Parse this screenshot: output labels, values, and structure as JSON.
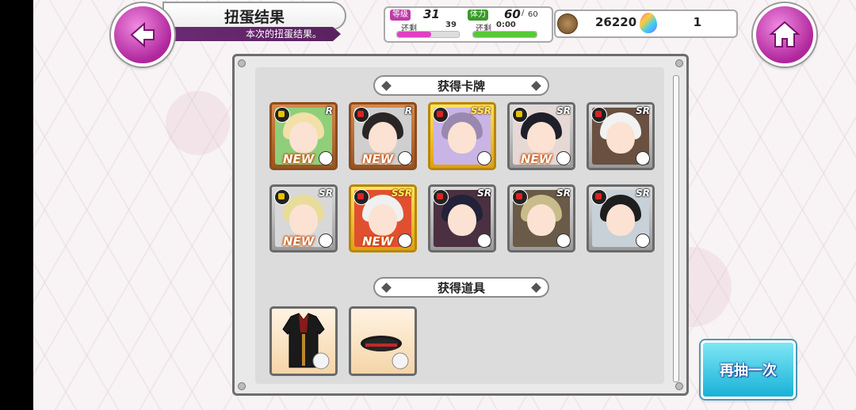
{
  "header": {
    "title": "扭蛋结果",
    "subtitle": "本次的扭蛋结果。"
  },
  "stats": {
    "level_label": "等级",
    "level_value": "31",
    "exp_label": "还剩",
    "exp_value": "39",
    "exp_fill": 0.55,
    "stamina_label": "体力",
    "stamina_value": "60",
    "stamina_sep": "/",
    "stamina_max": "60",
    "stamina_fill": 1.0,
    "recover_label": "还剩",
    "recover_value": "0:00"
  },
  "currency": {
    "coins": "26220",
    "gems": "1"
  },
  "cards_section": {
    "title": "获得卡牌",
    "cards": [
      {
        "rarity": "R",
        "type": "flash",
        "new": true,
        "hair": "#f2e0a8",
        "bg": "#8fcf7a",
        "new_label": "NEW"
      },
      {
        "rarity": "R",
        "type": "crimson",
        "new": true,
        "hair": "#2a2626",
        "bg": "#cfcfcf",
        "new_label": "NEW"
      },
      {
        "rarity": "SSR",
        "type": "crimson",
        "new": false,
        "hair": "#9a88b0",
        "bg": "#c9b4e6",
        "new_label": ""
      },
      {
        "rarity": "SR",
        "type": "flash",
        "new": true,
        "hair": "#1f1f2a",
        "bg": "#e6d8d4",
        "new_label": "NEW"
      },
      {
        "rarity": "SR",
        "type": "crimson",
        "new": false,
        "hair": "#f2f2f2",
        "bg": "#6a5040",
        "new_label": ""
      },
      {
        "rarity": "SR",
        "type": "flash",
        "new": true,
        "hair": "#e8dc9a",
        "bg": "#d8d8d8",
        "new_label": "NEW"
      },
      {
        "rarity": "SSR",
        "type": "crimson",
        "new": true,
        "hair": "#f0f0f0",
        "bg": "#e05030",
        "new_label": "NEW"
      },
      {
        "rarity": "SR",
        "type": "crimson",
        "new": false,
        "hair": "#22223a",
        "bg": "#4a3040",
        "new_label": ""
      },
      {
        "rarity": "SR",
        "type": "crimson",
        "new": false,
        "hair": "#c8bc8a",
        "bg": "#6a5a48",
        "new_label": ""
      },
      {
        "rarity": "SR",
        "type": "crimson",
        "new": false,
        "hair": "#1e1e1e",
        "bg": "#c8d0d8",
        "new_label": ""
      }
    ]
  },
  "items_section": {
    "title": "获得道具",
    "items": [
      {
        "icon": "uniform-jacket-icon"
      },
      {
        "icon": "hat-icon"
      }
    ]
  },
  "actions": {
    "draw_again": "再抽一次"
  },
  "colors": {
    "accent_magenta": "#b0269c",
    "button_cyan": "#18b2d8",
    "exp_bar": "#e040c0",
    "stamina_bar": "#58c838"
  }
}
